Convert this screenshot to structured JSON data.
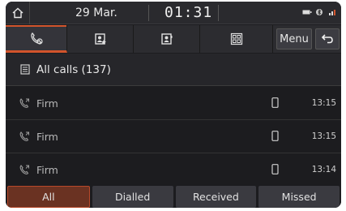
{
  "status_bar": {
    "date": "29 Mar.",
    "time": "01:31"
  },
  "tabs": [
    {
      "icon": "call-history-icon",
      "active": true
    },
    {
      "icon": "favorites-icon",
      "active": false
    },
    {
      "icon": "contacts-icon",
      "active": false
    },
    {
      "icon": "keypad-icon",
      "active": false
    }
  ],
  "toolbar": {
    "menu_label": "Menu",
    "back_icon": "back-arrow-icon"
  },
  "list": {
    "header": "All calls (137)",
    "rows": [
      {
        "name": "Firm",
        "time": "13:15",
        "device_icon": "mobile-icon"
      },
      {
        "name": "Firm",
        "time": "13:15",
        "device_icon": "mobile-icon"
      },
      {
        "name": "Firm",
        "time": "13:14",
        "device_icon": "mobile-icon"
      }
    ]
  },
  "filters": [
    {
      "label": "All",
      "active": true
    },
    {
      "label": "Dialled",
      "active": false
    },
    {
      "label": "Received",
      "active": false
    },
    {
      "label": "Missed",
      "active": false
    }
  ],
  "colors": {
    "accent": "#d2542c",
    "background": "#1c1c1f"
  }
}
